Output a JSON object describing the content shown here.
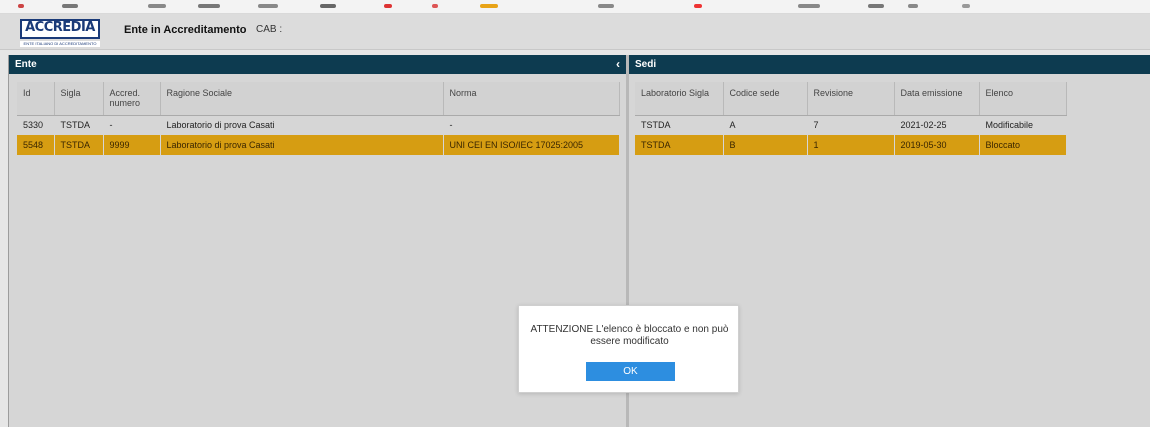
{
  "header": {
    "logo_text": "ACCREDIA",
    "logo_subtext": "ENTE ITALIANO DI ACCREDITAMENTO",
    "title": "Ente in Accreditamento",
    "cab_label": "CAB :"
  },
  "left_panel": {
    "title": "Ente",
    "collapse_glyph": "‹",
    "columns": [
      "Id",
      "Sigla",
      "Accred. numero",
      "Ragione Sociale",
      "Norma"
    ],
    "rows": [
      {
        "id": "5330",
        "sigla": "TSTDA",
        "accred": "-",
        "ragione": "Laboratorio di prova Casati",
        "norma": "-",
        "selected": false
      },
      {
        "id": "5548",
        "sigla": "TSTDA",
        "accred": "9999",
        "ragione": "Laboratorio di prova Casati",
        "norma": "UNI CEI EN ISO/IEC 17025:2005",
        "selected": true
      }
    ]
  },
  "right_panel": {
    "title": "Sedi",
    "columns": [
      "Laboratorio Sigla",
      "Codice sede",
      "Revisione",
      "Data emissione",
      "Elenco"
    ],
    "rows": [
      {
        "lab": "TSTDA",
        "codice": "A",
        "revisione": "7",
        "data": "2021-02-25",
        "elenco": "Modificabile",
        "selected": false
      },
      {
        "lab": "TSTDA",
        "codice": "B",
        "revisione": "1",
        "data": "2019-05-30",
        "elenco": "Bloccato",
        "selected": true
      }
    ]
  },
  "dialog": {
    "message": "ATTENZIONE L'elenco è bloccato e non può essere modificato",
    "ok_label": "OK"
  },
  "colors": {
    "panel_header": "#0d3b50",
    "selected_row": "#d69d12",
    "ok_button": "#2d8ee0",
    "logo": "#1a3a78"
  }
}
